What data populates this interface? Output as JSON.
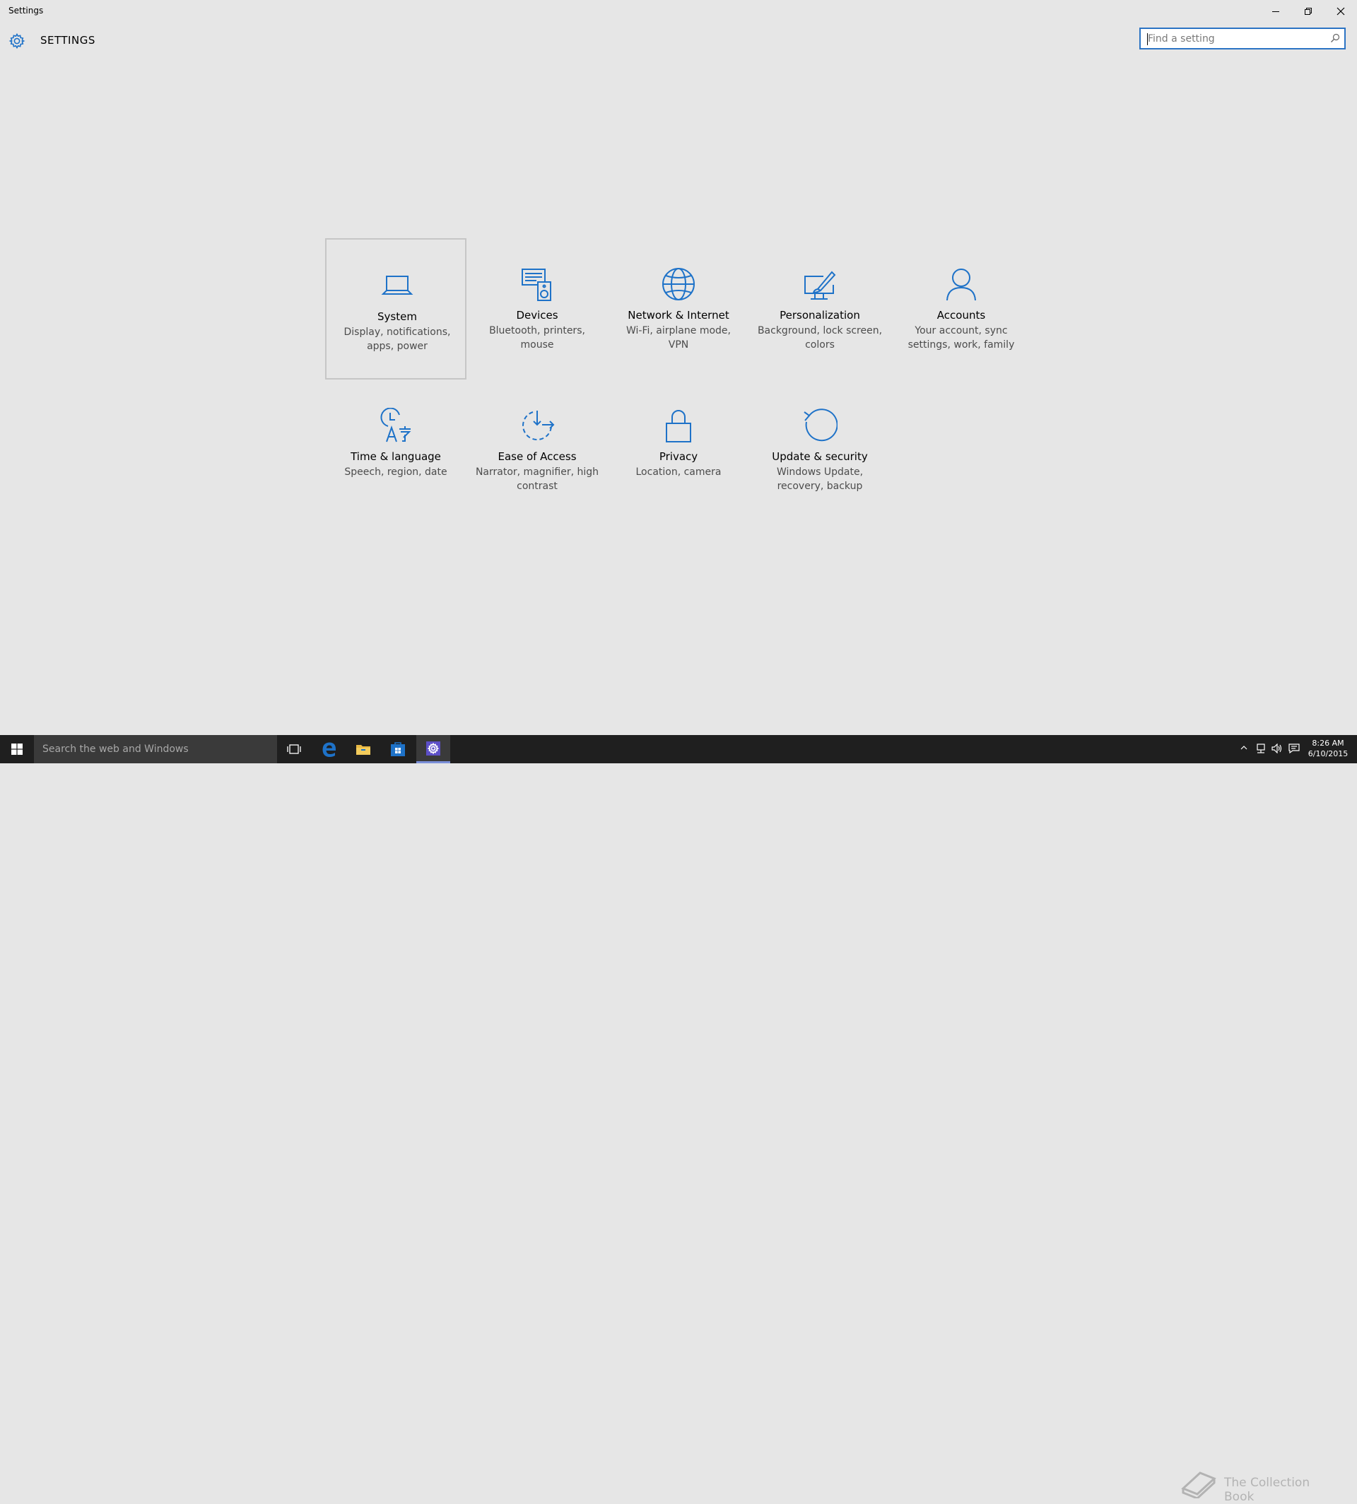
{
  "window": {
    "title": "Settings"
  },
  "header": {
    "app_title": "SETTINGS"
  },
  "search": {
    "placeholder": "Find a setting",
    "value": ""
  },
  "tiles": [
    {
      "name": "System",
      "desc": "Display, notifications, apps, power",
      "icon": "laptop-icon",
      "selected": true
    },
    {
      "name": "Devices",
      "desc": "Bluetooth, printers, mouse",
      "icon": "devices-icon"
    },
    {
      "name": "Network & Internet",
      "desc": "Wi-Fi, airplane mode, VPN",
      "icon": "globe-icon"
    },
    {
      "name": "Personalization",
      "desc": "Background, lock screen, colors",
      "icon": "paintbrush-icon"
    },
    {
      "name": "Accounts",
      "desc": "Your account, sync settings, work, family",
      "icon": "person-icon"
    },
    {
      "name": "Time & language",
      "desc": "Speech, region, date",
      "icon": "time-language-icon"
    },
    {
      "name": "Ease of Access",
      "desc": "Narrator, magnifier, high contrast",
      "icon": "ease-of-access-icon"
    },
    {
      "name": "Privacy",
      "desc": "Location, camera",
      "icon": "lock-icon"
    },
    {
      "name": "Update & security",
      "desc": "Windows Update, recovery, backup",
      "icon": "refresh-icon"
    }
  ],
  "taskbar": {
    "search_text": "Search the web and Windows",
    "clock_time": "8:26 AM",
    "clock_date": "6/10/2015",
    "watermark": "The Collection Book"
  },
  "colors": {
    "accent": "#1e72c8",
    "background": "#e6e6e6",
    "taskbar": "#1f1f1f"
  }
}
